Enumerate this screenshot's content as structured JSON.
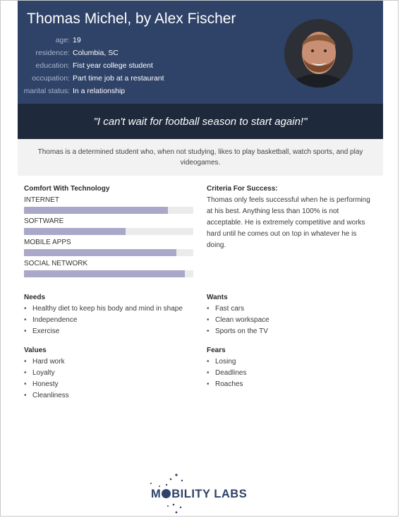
{
  "header": {
    "name": "Thomas Michel, by Alex Fischer",
    "details": [
      {
        "label": "age:",
        "value": "19"
      },
      {
        "label": "residence:",
        "value": "Columbia, SC"
      },
      {
        "label": "education:",
        "value": "Fist year college student"
      },
      {
        "label": "occupation:",
        "value": "Part time job at a restaurant"
      },
      {
        "label": "marital status:",
        "value": "In a relationship"
      }
    ]
  },
  "quote": "\"I can't wait for football season to start again!\"",
  "bio": "Thomas is a determined student who, when not studying, likes to play basketball, watch sports, and play videogames.",
  "comfort": {
    "title": "Comfort With Technology",
    "items": [
      {
        "label": "INTERNET",
        "level": 0.85
      },
      {
        "label": "SOFTWARE",
        "level": 0.6
      },
      {
        "label": "MOBILE APPS",
        "level": 0.9
      },
      {
        "label": "SOCIAL NETWORK",
        "level": 0.95
      }
    ]
  },
  "criteria": {
    "title": "Criteria For Success:",
    "text": "Thomas only feels successful when he is performing at his best. Anything less than 100% is not acceptable. He is extremely competitive and works hard until he comes out on top in whatever he is doing."
  },
  "needs": {
    "title": "Needs",
    "items": [
      "Healthy diet to keep his body and mind in shape",
      "Independence",
      "Exercise"
    ]
  },
  "wants": {
    "title": "Wants",
    "items": [
      "Fast cars",
      "Clean workspace",
      "Sports on the TV"
    ]
  },
  "values": {
    "title": "Values",
    "items": [
      "Hard work",
      "Loyalty",
      "Honesty",
      "Cleanliness"
    ]
  },
  "fears": {
    "title": "Fears",
    "items": [
      "Losing",
      "Deadlines",
      "Roaches"
    ]
  },
  "logo": {
    "text_before": "M",
    "text_after": "BILITY LABS"
  },
  "colors": {
    "header": "#2f4267",
    "quote_band": "#1e293b",
    "bar_fill": "#a9a8c8",
    "bar_track": "#ebebeb",
    "bio_band": "#f2f2f2"
  }
}
